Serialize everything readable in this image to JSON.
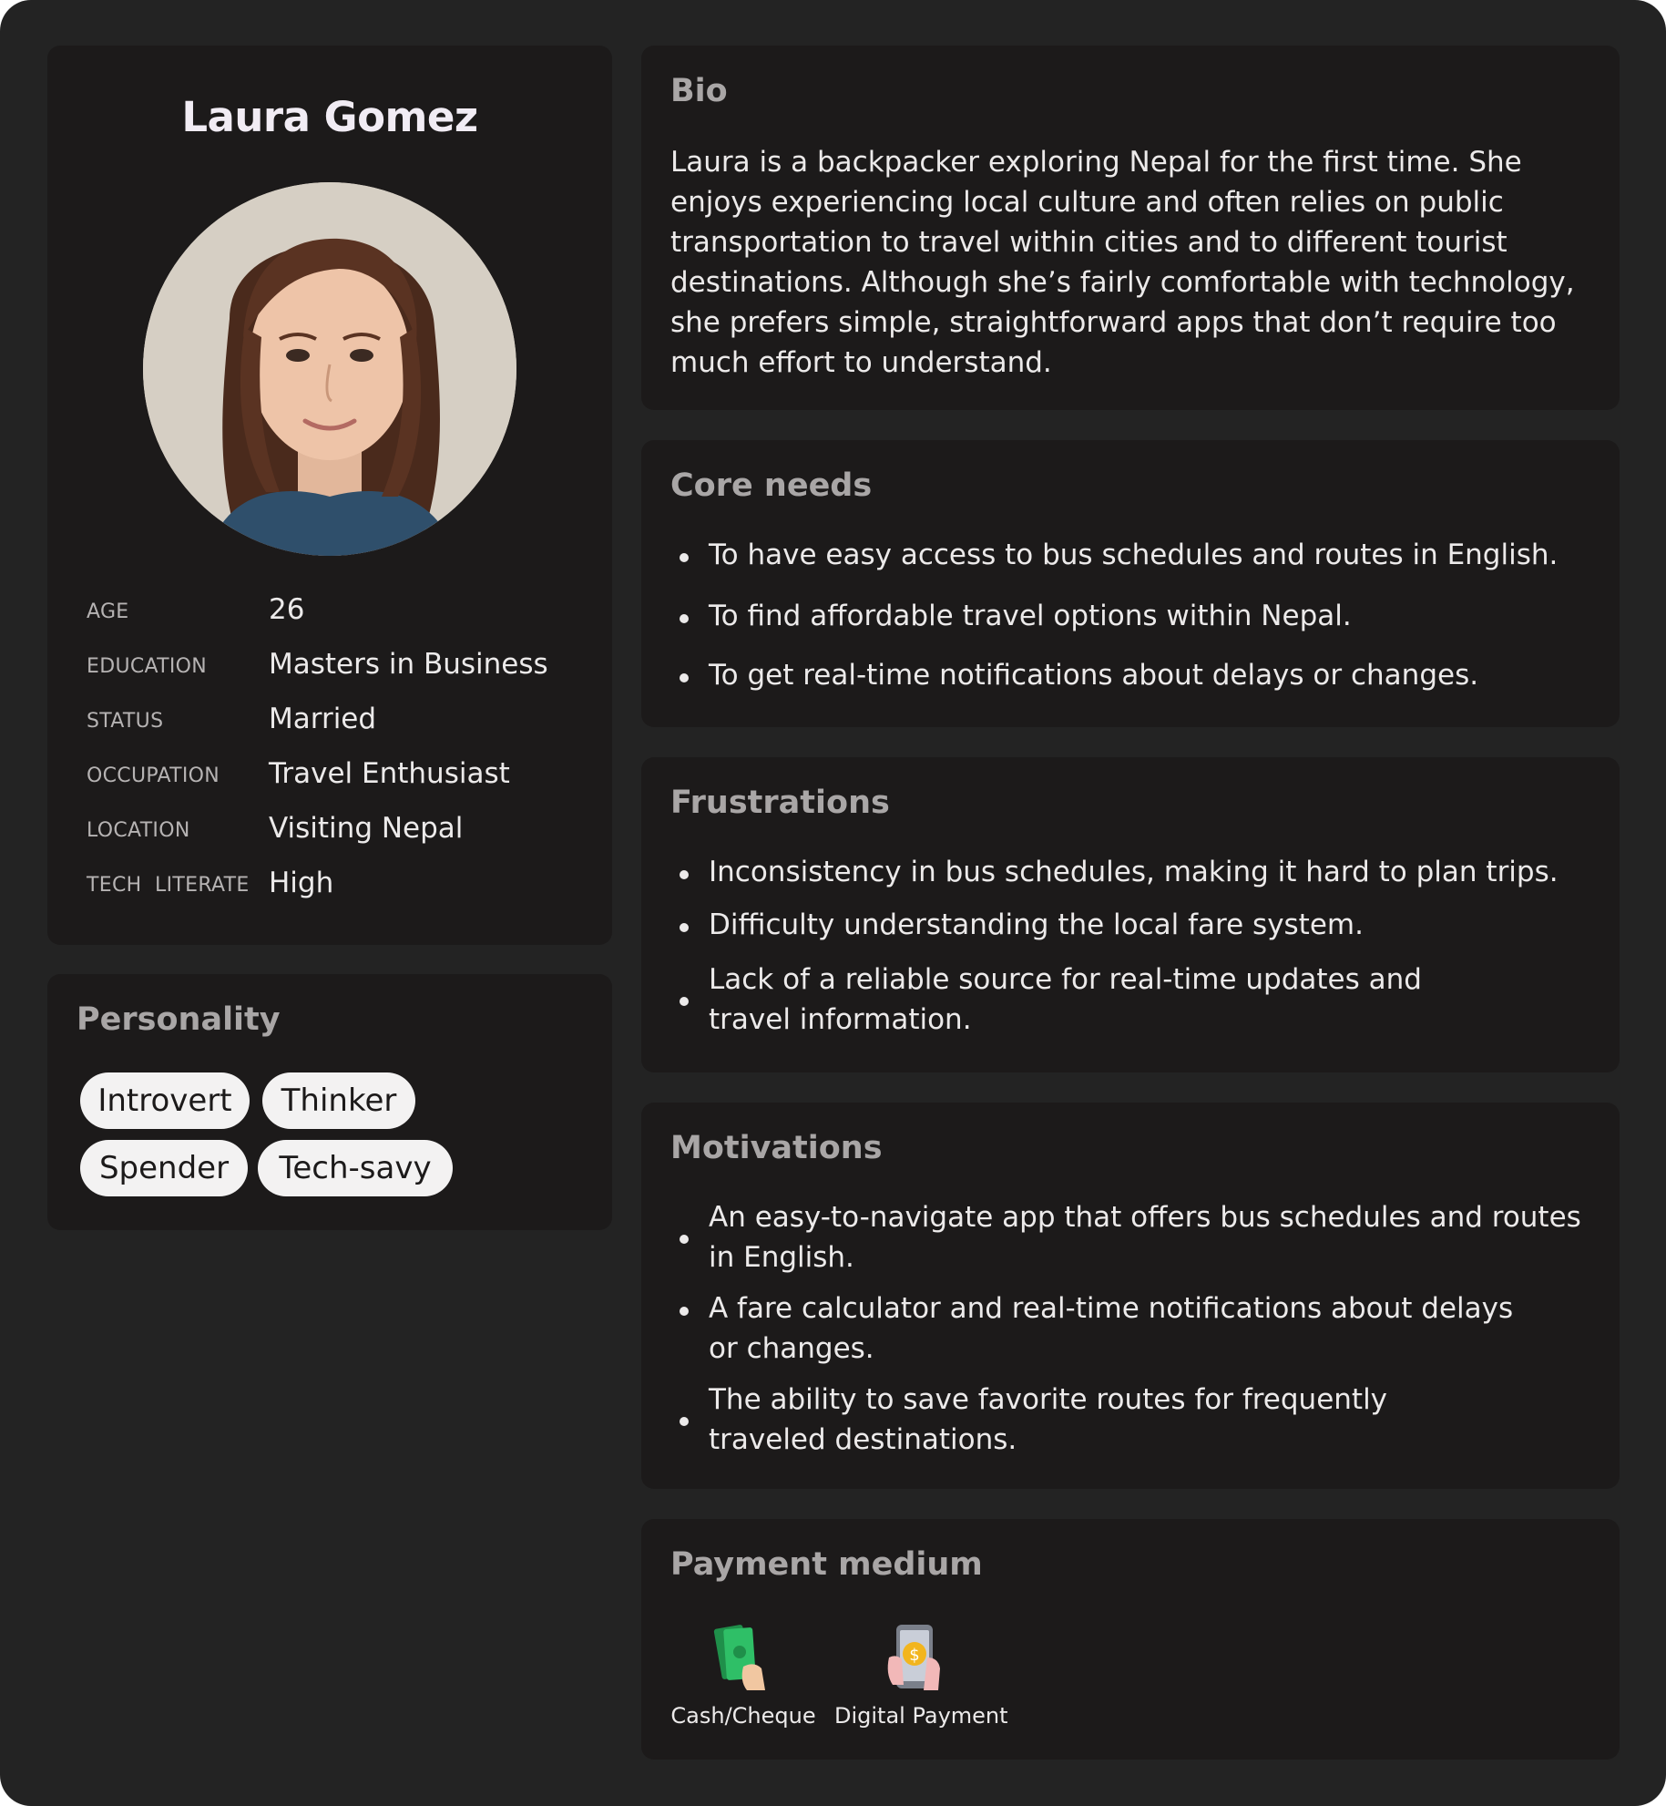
{
  "profile": {
    "name": "Laura Gomez",
    "facts": [
      {
        "label": "AGE",
        "value": "26"
      },
      {
        "label": "EDUCATION",
        "value": "Masters in Business"
      },
      {
        "label": "STATUS",
        "value": "Married"
      },
      {
        "label": "OCCUPATION",
        "value": "Travel Enthusiast"
      },
      {
        "label": "LOCATION",
        "value": "Visiting Nepal"
      },
      {
        "label": "TECH  LITERATE",
        "value": "High"
      }
    ]
  },
  "personality": {
    "title": "Personality",
    "traits": [
      "Introvert",
      "Thinker",
      "Spender",
      "Tech-savy"
    ]
  },
  "bio": {
    "title": "Bio",
    "text": "Laura is a backpacker exploring Nepal for the first time. She enjoys experiencing local culture and often relies on public transportation to travel within cities and to different tourist destinations. Although she’s fairly comfortable with technology, she prefers simple, straightforward apps that don’t require too much effort to understand."
  },
  "core_needs": {
    "title": "Core needs",
    "items": [
      "To have easy access to bus schedules and routes in English.",
      "To find affordable travel options within Nepal.",
      "To get real-time notifications about delays or changes."
    ]
  },
  "frustrations": {
    "title": "Frustrations",
    "items": [
      "Inconsistency in bus schedules, making it hard to plan trips.",
      "Difficulty understanding the local fare system.",
      "Lack of a reliable source for real-time updates and travel information."
    ]
  },
  "motivations": {
    "title": "Motivations",
    "items": [
      "An easy-to-navigate app that offers bus schedules and routes in English.",
      "A fare calculator and real-time notifications about delays or changes.",
      "The ability to save favorite routes for frequently traveled destinations."
    ]
  },
  "payment": {
    "title": "Payment medium",
    "methods": [
      {
        "label": "Cash/Cheque",
        "icon": "cash-in-hand-icon"
      },
      {
        "label": "Digital Payment",
        "icon": "phone-payment-icon"
      }
    ]
  },
  "colors": {
    "frame_bg": "#232323",
    "card_bg": "#1c1a1a",
    "title_gray": "#a9a6a6",
    "text": "#eceaea",
    "pill_bg": "#f3f2f2"
  }
}
